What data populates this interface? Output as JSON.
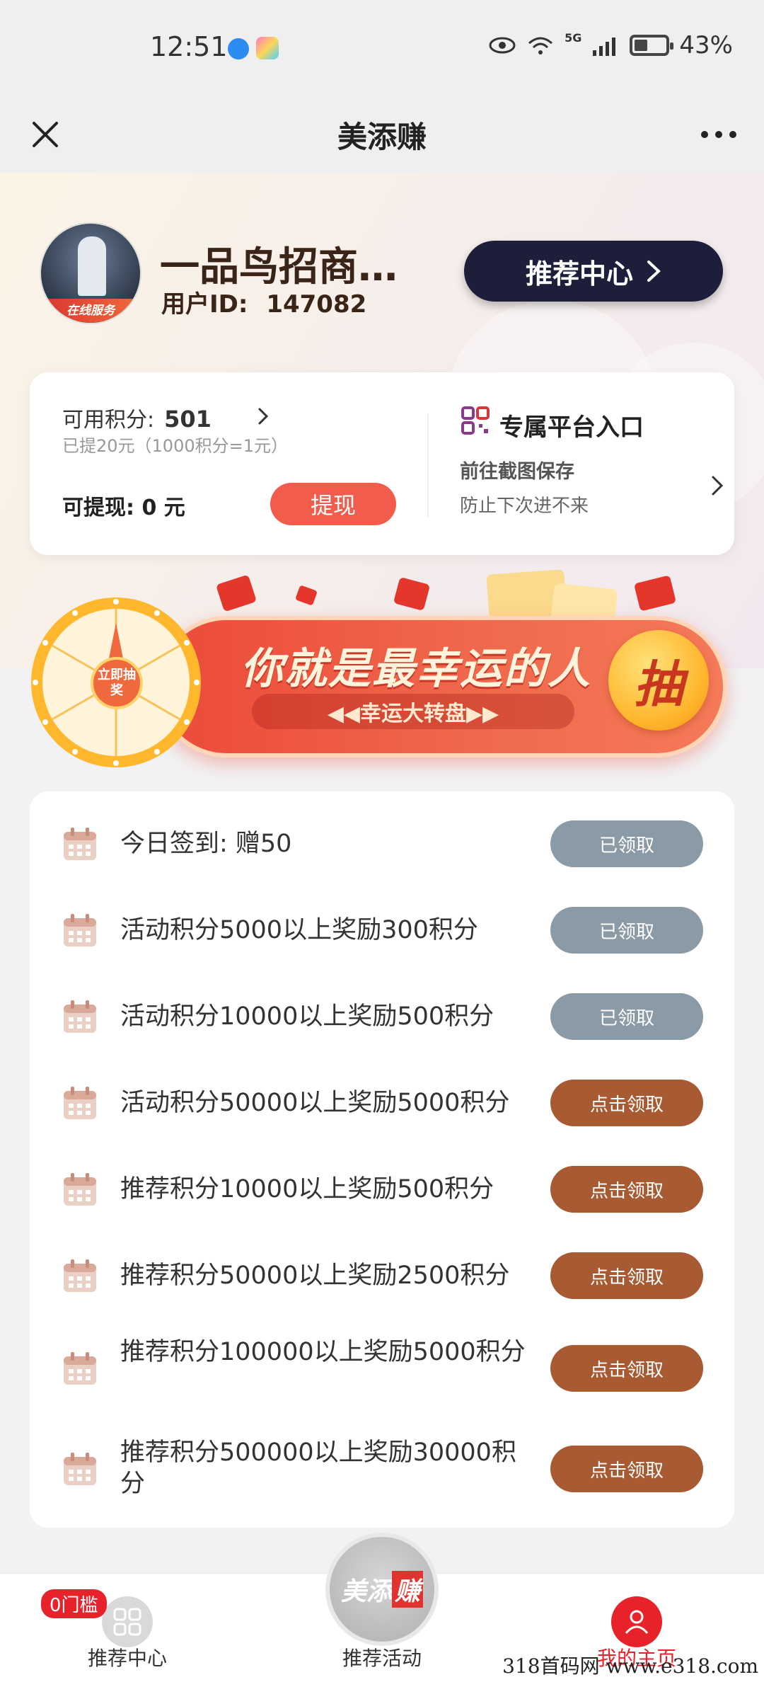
{
  "status": {
    "time": "12:51",
    "network": "5G",
    "battery": "43%"
  },
  "nav": {
    "title": "美添赚"
  },
  "profile": {
    "name": "一品鸟招商…",
    "user_id_label": "用户ID:",
    "user_id": "147082",
    "avatar_ribbon": "在线服务",
    "recommend_button": "推荐中心"
  },
  "points": {
    "available_label": "可用积分:",
    "available_value": "501",
    "hint": "已提20元（1000积分=1元）",
    "withdrawable": "可提现: 0 元",
    "withdraw_button": "提现",
    "entry_title": "专属平台入口",
    "entry_sub": "前往截图保存",
    "entry_note": "防止下次进不来"
  },
  "lottery": {
    "title": "你就是最幸运的人",
    "subtitle": "◀◀幸运大转盘▶▶",
    "draw_button": "抽",
    "wheel_button": "立即抽奖"
  },
  "tasks": [
    {
      "label": "今日签到: 赠50",
      "button": "已领取",
      "state": "done"
    },
    {
      "label": "活动积分5000以上奖励300积分",
      "button": "已领取",
      "state": "done"
    },
    {
      "label": "活动积分10000以上奖励500积分",
      "button": "已领取",
      "state": "done"
    },
    {
      "label": "活动积分50000以上奖励5000积分",
      "button": "点击领取",
      "state": "claim"
    },
    {
      "label": "推荐积分10000以上奖励500积分",
      "button": "点击领取",
      "state": "claim"
    },
    {
      "label": "推荐积分50000以上奖励2500积分",
      "button": "点击领取",
      "state": "claim"
    },
    {
      "label": "推荐积分100000以上奖励5000积分",
      "button": "点击领取",
      "state": "claim"
    },
    {
      "label": "推荐积分500000以上奖励30000积分",
      "button": "点击领取",
      "state": "claim"
    }
  ],
  "tabbar": {
    "badge": "0门槛",
    "tab1": "推荐中心",
    "tab2": "推荐活动",
    "tab3": "我的主页",
    "logo_a": "美添",
    "logo_b": "赚"
  },
  "watermark": "318首码网 www.e318.com",
  "colors": {
    "accent": "#f25c4c",
    "claim": "#a85a32",
    "done": "#8a9aa6",
    "dark_button": "#1d1f3a"
  }
}
